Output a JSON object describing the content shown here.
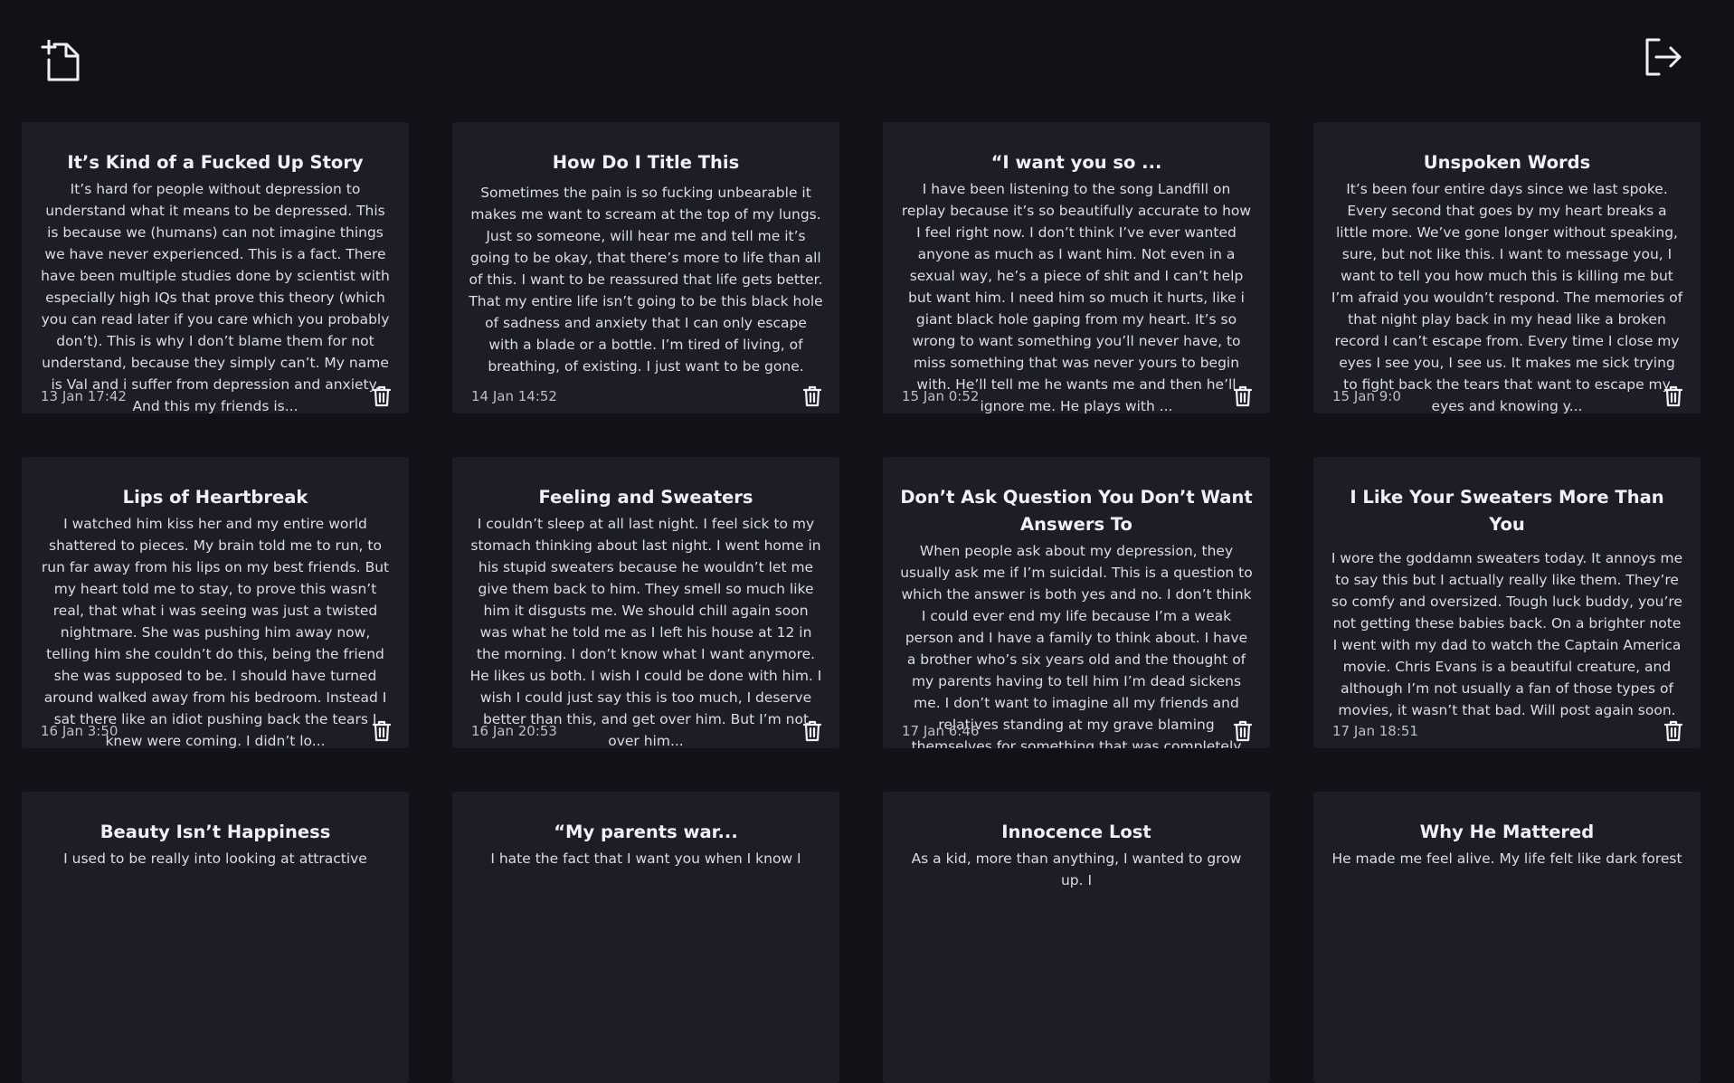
{
  "toolbar": {
    "new_note_icon": "new-document-icon",
    "logout_icon": "logout-icon"
  },
  "notes": [
    {
      "title": "It’s Kind of a Fucked Up Story",
      "body": "It’s hard for people without depression to understand what it means to be depressed. This is because we (humans) can not imagine things we have never experienced. This is a fact. There have been multiple studies done by scientist with especially high IQs that prove this theory (which you can read later if you care which you probably don’t). This is why I don’t blame them for not understand, because they simply can’t. My name is Val and i suffer from depression and anxiety. And this my friends is...",
      "date": "13 Jan 17:42"
    },
    {
      "title": "How Do I Title This",
      "body": "Sometimes the pain is so fucking unbearable it makes me want to scream at the top of my lungs. Just so someone, will hear me and tell me it’s going to be okay, that there’s more to life than all of this. I want to be reassured that life gets better. That my entire life isn’t going to be this black hole of sadness and anxiety that I can only escape with a blade or a bottle. I’m tired of living, of breathing, of existing. I just want to be gone.",
      "date": "14 Jan 14:52"
    },
    {
      "title": "“I want you so ...",
      "body": "I have been listening to the song Landfill on replay because it’s so beautifully accurate to how I feel right now. I don’t think I’ve ever wanted anyone as much as I want him. Not even in a sexual way, he’s a piece of shit and I can’t help but want him. I need him so much it hurts, like i giant black hole gaping from my heart. It’s so wrong to want something you’ll never have, to miss something that was never yours to begin with. He’ll tell me he wants me and then he’ll ignore me. He plays with ...",
      "date": "15 Jan 0:52"
    },
    {
      "title": "Unspoken Words",
      "body": "It’s been four entire days since we last spoke. Every second that goes by my heart breaks a little more. We’ve gone longer without speaking, sure, but not like this. I want to message you, I want to tell you how much this is killing me but I’m afraid you wouldn’t respond. The memories of that night play back in my head like a broken record I can’t escape from. Every time I close my eyes I see you, I see us. It makes me sick trying to fight back the tears that want to escape my eyes and knowing y...",
      "date": "15 Jan 9:0"
    },
    {
      "title": "Lips of Heartbreak",
      "body": "I watched him kiss her and my entire world shattered to pieces. My brain told me to run, to run far away from his lips on my best friends. But my heart told me to stay, to prove this wasn’t real, that what i was seeing was just a twisted nightmare. She was pushing him away now, telling him she couldn’t do this, being the friend she was supposed to be. I should have turned around walked away from his bedroom. Instead I sat there like an idiot pushing back the tears I knew were coming. I didn’t lo...",
      "date": "16 Jan 3:50"
    },
    {
      "title": "Feeling and Sweaters",
      "body": "I couldn’t sleep at all last night. I feel sick to my stomach thinking about last night. I went home in his stupid sweaters because he wouldn’t let me give them back to him. They smell so much like him it disgusts me. We should chill again soon was what he told me as I left his house at 12 in the morning. I don’t know what I want anymore. He likes us both. I wish I could be done with him. I wish I could just say this is too much, I deserve better than this, and get over him. But I’m not over him...",
      "date": "16 Jan 20:53"
    },
    {
      "title": "Don’t Ask Question You Don’t Want Answers To",
      "body": "When people ask about my depression, they usually ask me if I’m suicidal. This is a question to which the answer is both yes and no. I don’t think I could ever end my life because I’m a weak person and I have a family to think about. I have a brother who’s six years old and the thought of my parents having to tell him I’m dead sickens me. I don’t want to imagine all my friends and relatives standing at my grave blaming themselves for something that was completely out of their control. Yet most d...",
      "date": "17 Jan 6:46"
    },
    {
      "title": "I Like Your Sweaters More Than You",
      "body": "I wore the goddamn sweaters today. It annoys me to say this but I actually really like them. They’re so comfy and oversized. Tough luck buddy, you’re not getting these babies back. On a brighter note I went with my dad to watch the Captain America movie. Chris Evans is a beautiful creature, and although I’m not usually a fan of those types of movies, it wasn’t that bad. Will post again soon.",
      "date": "17 Jan 18:51"
    },
    {
      "title": "Beauty Isn’t Happiness",
      "body": "I used to be really into looking at attractive",
      "date": ""
    },
    {
      "title": "“My parents war...",
      "body": "I hate the fact that I want you when I know I",
      "date": ""
    },
    {
      "title": "Innocence Lost",
      "body": "As a kid, more than anything, I wanted to grow up. I",
      "date": ""
    },
    {
      "title": "Why He Mattered",
      "body": "He made me feel alive. My life felt like dark forest",
      "date": ""
    }
  ]
}
